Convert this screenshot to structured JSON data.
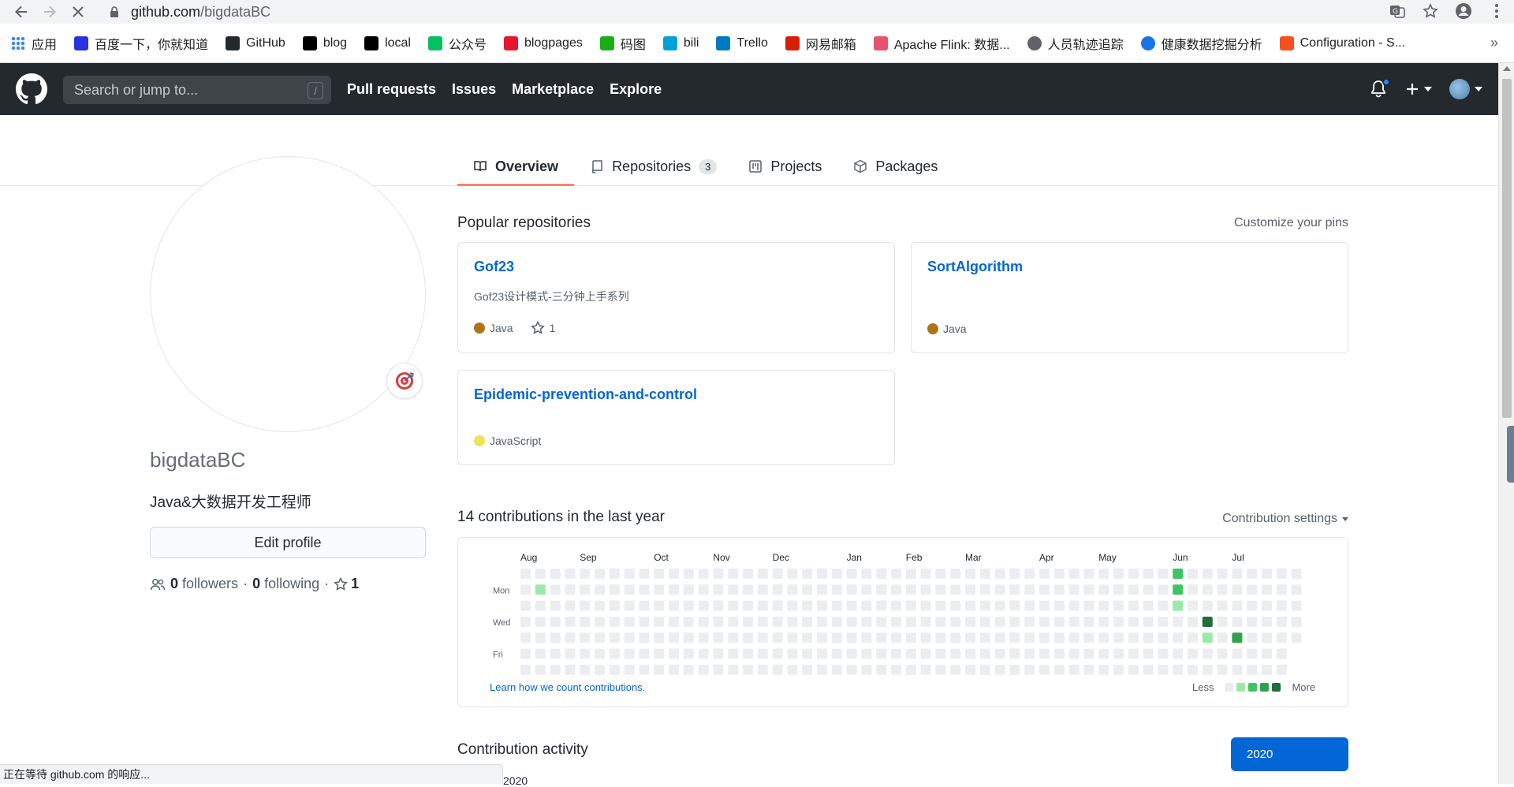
{
  "browser": {
    "url_host": "github.com",
    "url_path": "/bigdataBC",
    "bookmarks": [
      {
        "label": "应用",
        "icon": "apps-grid-icon",
        "color": "#4285f4"
      },
      {
        "label": "百度一下，你就知道",
        "icon": "baidu-paw-icon",
        "color": "#2932e1"
      },
      {
        "label": "GitHub",
        "icon": "github-icon",
        "color": "#24292e"
      },
      {
        "label": "blog",
        "icon": "terminal-icon",
        "color": "#000000"
      },
      {
        "label": "local",
        "icon": "terminal-icon",
        "color": "#000000"
      },
      {
        "label": "公众号",
        "icon": "wechat-icon",
        "color": "#07c160"
      },
      {
        "label": "blogpages",
        "icon": "weibo-icon",
        "color": "#e6162d"
      },
      {
        "label": "码图",
        "icon": "leaf-icon",
        "color": "#1aad19"
      },
      {
        "label": "bili",
        "icon": "bilibili-icon",
        "color": "#00a1d6"
      },
      {
        "label": "Trello",
        "icon": "trello-icon",
        "color": "#0079bf"
      },
      {
        "label": "网易邮箱",
        "icon": "netease-mail-icon",
        "color": "#d81e06"
      },
      {
        "label": "Apache Flink: 数据...",
        "icon": "flink-squirrel-icon",
        "color": "#e6526f"
      },
      {
        "label": "人员轨迹追踪",
        "icon": "globe-icon",
        "color": "#5f6368"
      },
      {
        "label": "健康数据挖掘分析",
        "icon": "blue-circle-icon",
        "color": "#1a73e8"
      },
      {
        "label": "Configuration - S...",
        "icon": "spring-icon",
        "color": "#f4511e"
      }
    ],
    "more_label": "»",
    "status_bar": "正在等待 github.com 的响应..."
  },
  "header": {
    "search_placeholder": "Search or jump to...",
    "slash": "/",
    "nav": [
      "Pull requests",
      "Issues",
      "Marketplace",
      "Explore"
    ]
  },
  "tabs": [
    {
      "label": "Overview",
      "icon": "book-icon",
      "count": null,
      "selected": true
    },
    {
      "label": "Repositories",
      "icon": "repo-icon",
      "count": "3",
      "selected": false
    },
    {
      "label": "Projects",
      "icon": "project-icon",
      "count": null,
      "selected": false
    },
    {
      "label": "Packages",
      "icon": "package-icon",
      "count": null,
      "selected": false
    }
  ],
  "profile": {
    "username": "bigdataBC",
    "bio": "Java&大数据开发工程师",
    "edit_label": "Edit profile",
    "followers_count": "0",
    "followers_label": "followers",
    "following_count": "0",
    "following_label": "following",
    "stars_count": "1",
    "sep": "·"
  },
  "popular": {
    "title": "Popular repositories",
    "customize_label": "Customize your pins",
    "repos": [
      {
        "name": "Gof23",
        "description": "Gof23设计模式-三分钟上手系列",
        "language": "Java",
        "language_color": "#b07219",
        "stars": "1"
      },
      {
        "name": "SortAlgorithm",
        "description": "",
        "language": "Java",
        "language_color": "#b07219",
        "stars": null
      },
      {
        "name": "Epidemic-prevention-and-control",
        "description": "",
        "language": "JavaScript",
        "language_color": "#f1e05a",
        "stars": null
      }
    ]
  },
  "contributions": {
    "title": "14 contributions in the last year",
    "settings_label": "Contribution settings",
    "months": [
      "Aug",
      "Sep",
      "Oct",
      "Nov",
      "Dec",
      "Jan",
      "Feb",
      "Mar",
      "Apr",
      "May",
      "Jun",
      "Jul"
    ],
    "day_labels": [
      "Mon",
      "Wed",
      "Fri"
    ],
    "learn_label": "Learn how we count contributions.",
    "less_label": "Less",
    "more_label": "More",
    "level_colors": [
      "#ebedf0",
      "#9be9a8",
      "#40c463",
      "#30a14e",
      "#216e39"
    ],
    "active_cells": [
      {
        "week": 1,
        "day": 1,
        "level": 1
      },
      {
        "week": 44,
        "day": 0,
        "level": 2
      },
      {
        "week": 44,
        "day": 1,
        "level": 2
      },
      {
        "week": 44,
        "day": 2,
        "level": 1
      },
      {
        "week": 46,
        "day": 3,
        "level": 4
      },
      {
        "week": 46,
        "day": 4,
        "level": 1
      },
      {
        "week": 48,
        "day": 4,
        "level": 3
      }
    ]
  },
  "activity": {
    "title": "Contribution activity",
    "year": "2020",
    "peek_text": "2020"
  }
}
